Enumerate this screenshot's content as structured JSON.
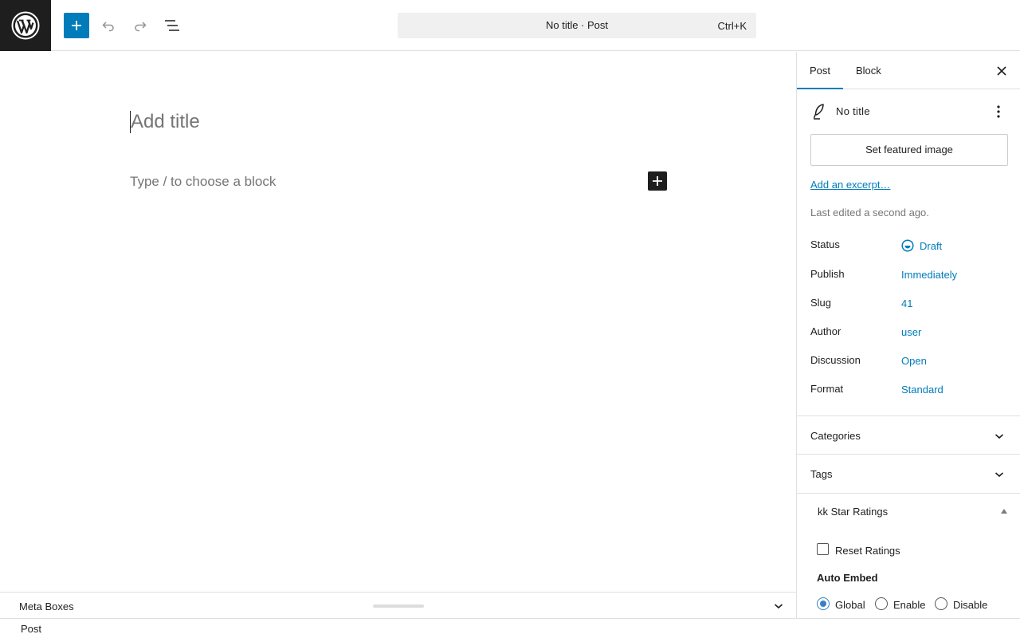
{
  "header": {
    "command_bar": {
      "title": "No title · Post",
      "shortcut": "Ctrl+K"
    }
  },
  "editor": {
    "title_placeholder": "Add title",
    "block_placeholder": "Type / to choose a block"
  },
  "meta_boxes": {
    "label": "Meta Boxes"
  },
  "footer": {
    "breadcrumb": "Post"
  },
  "sidebar": {
    "tabs": [
      {
        "label": "Post",
        "active": true
      },
      {
        "label": "Block",
        "active": false
      }
    ],
    "post_title": "No title",
    "featured_image_label": "Set featured image",
    "excerpt_link": "Add an excerpt…",
    "last_edited": "Last edited a second ago.",
    "rows": [
      {
        "label": "Status",
        "value": "Draft"
      },
      {
        "label": "Publish",
        "value": "Immediately"
      },
      {
        "label": "Slug",
        "value": "41"
      },
      {
        "label": "Author",
        "value": "user"
      },
      {
        "label": "Discussion",
        "value": "Open"
      },
      {
        "label": "Format",
        "value": "Standard"
      }
    ],
    "panels": [
      {
        "label": "Categories"
      },
      {
        "label": "Tags"
      }
    ],
    "kk_star": {
      "title": "kk Star Ratings",
      "reset_label": "Reset Ratings",
      "auto_embed_heading": "Auto Embed",
      "options": [
        {
          "label": "Global",
          "selected": true
        },
        {
          "label": "Enable",
          "selected": false
        },
        {
          "label": "Disable",
          "selected": false
        }
      ]
    }
  },
  "colors": {
    "accent": "#007cba",
    "dark": "#1e1e1e",
    "muted": "#757575"
  }
}
